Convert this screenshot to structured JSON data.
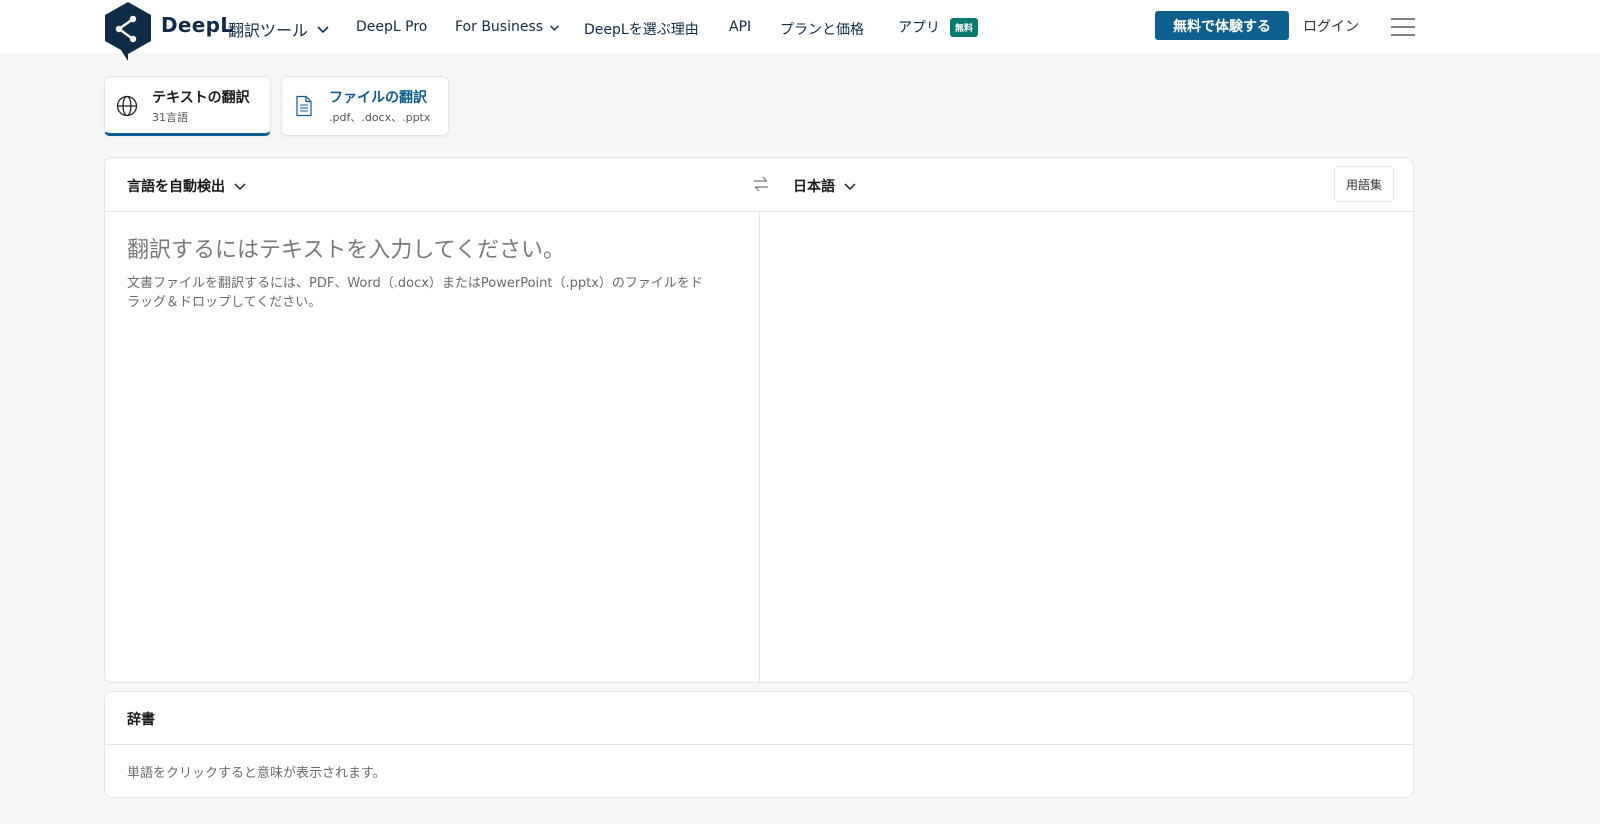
{
  "brand": {
    "name": "DeepL",
    "product": "翻訳ツール"
  },
  "nav": {
    "items": [
      {
        "label": "DeepL Pro"
      },
      {
        "label": "For Business"
      },
      {
        "label": "DeepLを選ぶ理由"
      },
      {
        "label": "API"
      },
      {
        "label": "プランと価格"
      },
      {
        "label": "アプリ"
      }
    ],
    "app_badge": "無料",
    "cta": "無料で体験する",
    "login": "ログイン"
  },
  "tabs": [
    {
      "title": "テキストの翻訳",
      "subtitle": "31言語",
      "icon": "globe-icon"
    },
    {
      "title": "ファイルの翻訳",
      "subtitle": ".pdf、.docx、.pptx",
      "icon": "document-icon"
    }
  ],
  "translator": {
    "source_lang": "言語を自動検出",
    "target_lang": "日本語",
    "glossary": "用語集",
    "placeholder": "翻訳するにはテキストを入力してください。",
    "hint": "文書ファイルを翻訳するには、PDF、Word（.docx）またはPowerPoint（.pptx）のファイルをドラッグ＆ドロップしてください。"
  },
  "dictionary": {
    "title": "辞書",
    "hint": "単語をクリックすると意味が表示されます。"
  },
  "colors": {
    "brand": "#0f2b46",
    "accent": "#0f5f8e",
    "badge": "#0b7b6f"
  }
}
